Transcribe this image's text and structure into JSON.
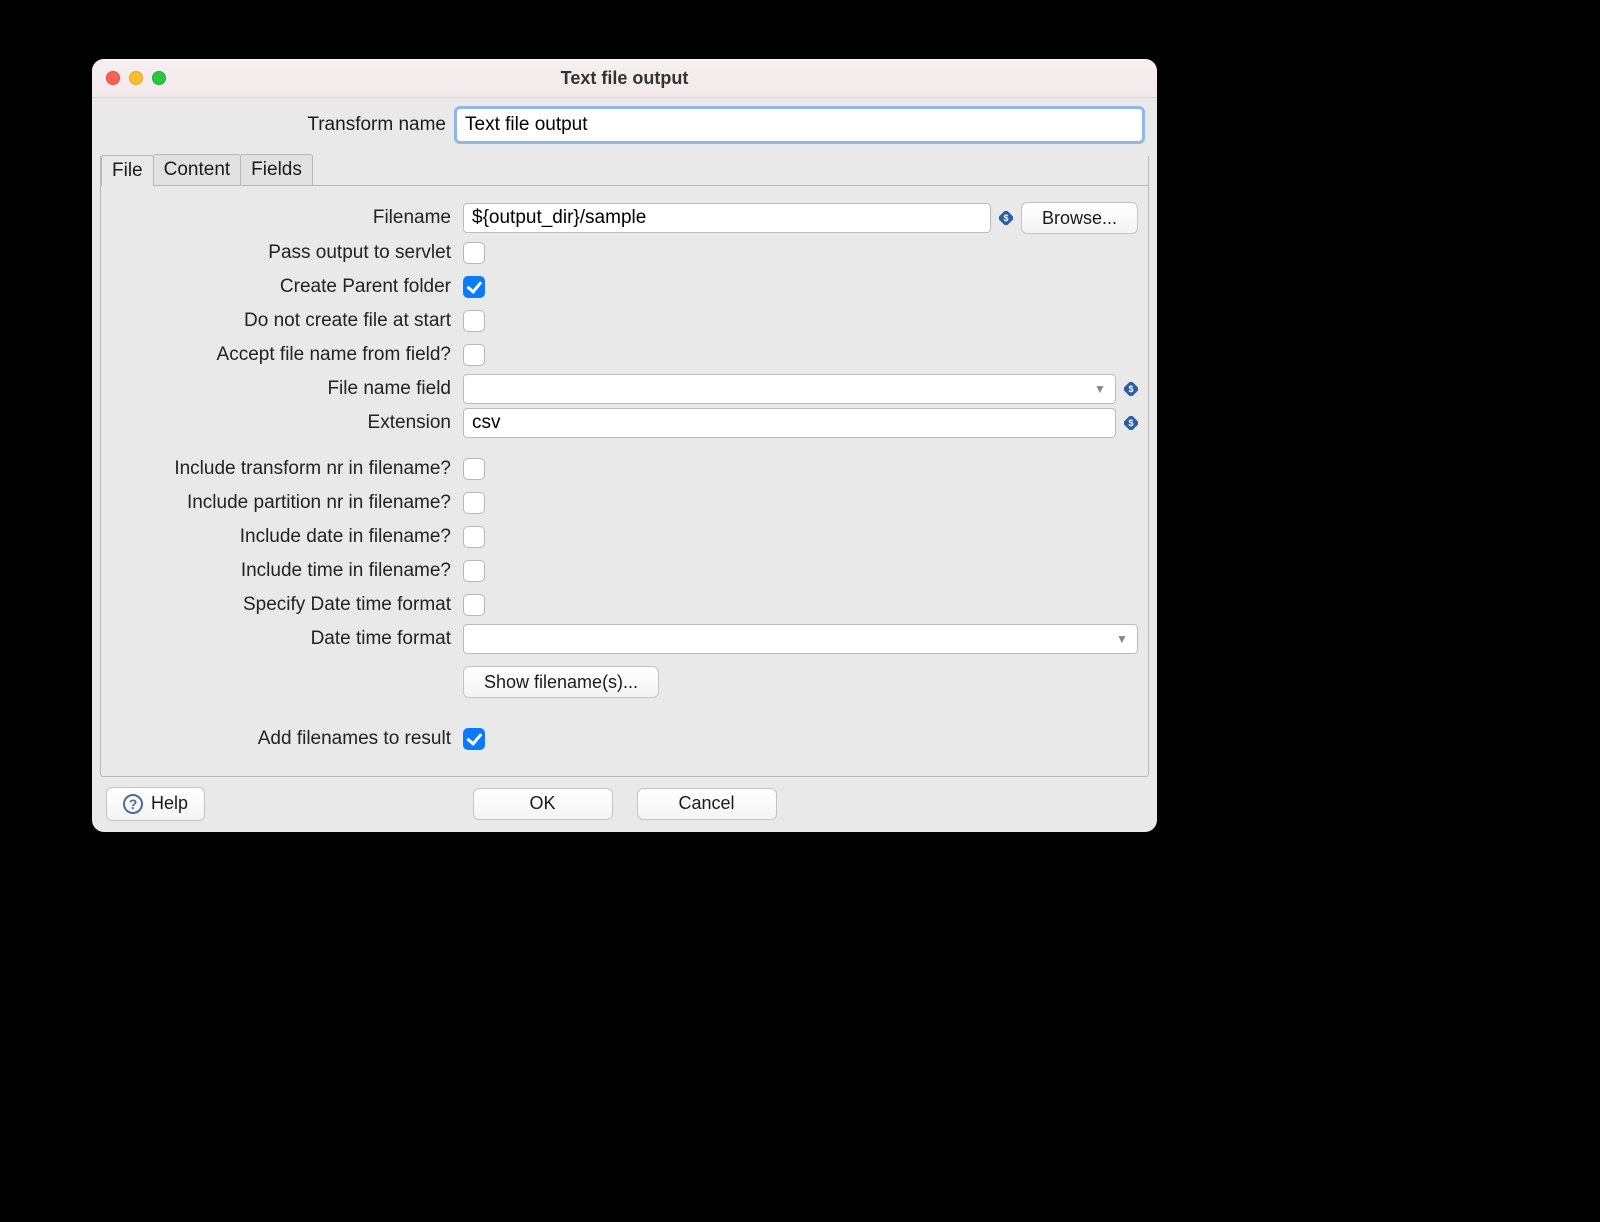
{
  "window": {
    "title": "Text file output"
  },
  "transform": {
    "label": "Transform name",
    "value": "Text file output"
  },
  "tabs": {
    "file": "File",
    "content": "Content",
    "fields": "Fields"
  },
  "file": {
    "filename_label": "Filename",
    "filename_value": "${output_dir}/sample",
    "browse": "Browse...",
    "pass_servlet_label": "Pass output to servlet",
    "pass_servlet_checked": false,
    "create_parent_label": "Create Parent folder",
    "create_parent_checked": true,
    "no_create_start_label": "Do not create file at start",
    "no_create_start_checked": false,
    "accept_fn_field_label": "Accept file name from field?",
    "accept_fn_field_checked": false,
    "fn_field_label": "File name field",
    "fn_field_value": "",
    "extension_label": "Extension",
    "extension_value": "csv",
    "inc_transform_label": "Include transform nr in filename?",
    "inc_transform_checked": false,
    "inc_partition_label": "Include partition nr in filename?",
    "inc_partition_checked": false,
    "inc_date_label": "Include date in filename?",
    "inc_date_checked": false,
    "inc_time_label": "Include time in filename?",
    "inc_time_checked": false,
    "spec_dt_label": "Specify Date time format",
    "spec_dt_checked": false,
    "dt_format_label": "Date time format",
    "dt_format_value": "",
    "show_filenames": "Show filename(s)...",
    "add_result_label": "Add filenames to result",
    "add_result_checked": true
  },
  "footer": {
    "help": "Help",
    "ok": "OK",
    "cancel": "Cancel"
  }
}
